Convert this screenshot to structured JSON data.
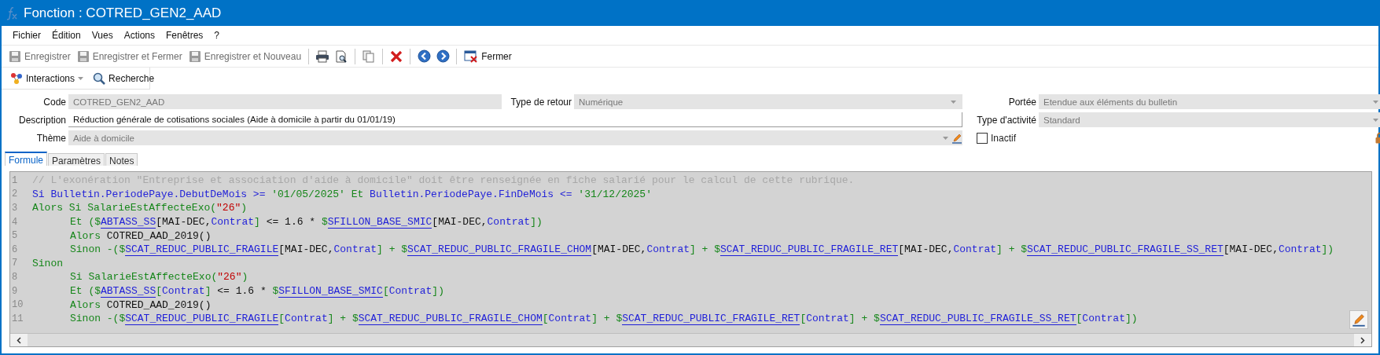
{
  "window": {
    "title": "Fonction : COTRED_GEN2_AAD"
  },
  "menu": [
    "Fichier",
    "Édition",
    "Vues",
    "Actions",
    "Fenêtres",
    "?"
  ],
  "toolbar": {
    "save": {
      "label": "Enregistrer",
      "disabled": true
    },
    "save_close": {
      "label": "Enregistrer et Fermer",
      "disabled": true
    },
    "save_new": {
      "label": "Enregistrer et Nouveau",
      "disabled": true
    },
    "close": {
      "label": "Fermer",
      "disabled": false
    }
  },
  "secondary_toolbar": {
    "interactions": "Interactions",
    "search": "Recherche"
  },
  "form": {
    "code": {
      "label": "Code",
      "value": "COTRED_GEN2_AAD"
    },
    "return_type": {
      "label": "Type de retour",
      "value": "Numérique"
    },
    "scope": {
      "label": "Portée",
      "value": "Etendue aux éléments du bulletin"
    },
    "description": {
      "label": "Description",
      "value": "Réduction générale de cotisations sociales (Aide à domicile à partir du 01/01/19)"
    },
    "activity_type": {
      "label": "Type d'activité",
      "value": "Standard"
    },
    "theme": {
      "label": "Thème",
      "value": "Aide à domicile"
    },
    "inactive": {
      "label": "Inactif",
      "checked": false
    }
  },
  "tabs": [
    {
      "label": "Formule",
      "selected": true
    },
    {
      "label": "Paramètres",
      "selected": false
    },
    {
      "label": "Notes",
      "selected": false
    }
  ],
  "editor": {
    "lines": [
      {
        "number": "1",
        "indented": false,
        "tokens": [
          {
            "kind": "comment",
            "text": "// L'exonération \"Entreprise et association d'aide à domicile\" doit être renseignée en fiche salarié pour le calcul de cette rubrique."
          }
        ]
      },
      {
        "number": "2",
        "indented": false,
        "tokens": [
          {
            "kind": "identifier",
            "text": "Si Bulletin.PeriodePaye.DebutDeMois >= "
          },
          {
            "kind": "keyword",
            "text": "'01/05/2025' Et "
          },
          {
            "kind": "identifier",
            "text": "Bulletin.PeriodePaye.FinDeMois <= "
          },
          {
            "kind": "keyword",
            "text": "'31/12/2025'"
          }
        ]
      },
      {
        "number": "3",
        "indented": false,
        "tokens": [
          {
            "kind": "keyword",
            "text": "Alors Si SalarieEstAffecteExo("
          },
          {
            "kind": "string",
            "text": "\"26\""
          },
          {
            "kind": "keyword",
            "text": ")"
          }
        ]
      },
      {
        "number": "4",
        "indented": true,
        "tokens": [
          {
            "kind": "keyword",
            "text": "Et ($"
          },
          {
            "kind": "variable",
            "text": "ABTASS_SS"
          },
          {
            "kind": "plain",
            "text": "[MAI-DEC,"
          },
          {
            "kind": "identifier",
            "text": "Contrat"
          },
          {
            "kind": "keyword",
            "text": "]"
          },
          {
            "kind": "plain",
            "text": " <= 1.6 * "
          },
          {
            "kind": "keyword",
            "text": "$"
          },
          {
            "kind": "variable",
            "text": "SFILLON_BASE_SMIC"
          },
          {
            "kind": "plain",
            "text": "[MAI-DEC,"
          },
          {
            "kind": "identifier",
            "text": "Contrat"
          },
          {
            "kind": "keyword",
            "text": "])"
          }
        ]
      },
      {
        "number": "5",
        "indented": true,
        "tokens": [
          {
            "kind": "keyword",
            "text": "Alors "
          },
          {
            "kind": "plain",
            "text": "COTRED_AAD_2019()"
          }
        ]
      },
      {
        "number": "6",
        "indented": true,
        "tokens": [
          {
            "kind": "keyword",
            "text": "Sinon -($"
          },
          {
            "kind": "variable",
            "text": "SCAT_REDUC_PUBLIC_FRAGILE"
          },
          {
            "kind": "plain",
            "text": "[MAI-DEC,"
          },
          {
            "kind": "identifier",
            "text": "Contrat"
          },
          {
            "kind": "keyword",
            "text": "] + $"
          },
          {
            "kind": "variable",
            "text": "SCAT_REDUC_PUBLIC_FRAGILE_CHOM"
          },
          {
            "kind": "plain",
            "text": "[MAI-DEC,"
          },
          {
            "kind": "identifier",
            "text": "Contrat"
          },
          {
            "kind": "keyword",
            "text": "] + $"
          },
          {
            "kind": "variable",
            "text": "SCAT_REDUC_PUBLIC_FRAGILE_RET"
          },
          {
            "kind": "plain",
            "text": "[MAI-DEC,"
          },
          {
            "kind": "identifier",
            "text": "Contrat"
          },
          {
            "kind": "keyword",
            "text": "] + $"
          },
          {
            "kind": "variable",
            "text": "SCAT_REDUC_PUBLIC_FRAGILE_SS_RET"
          },
          {
            "kind": "plain",
            "text": "[MAI-DEC,"
          },
          {
            "kind": "identifier",
            "text": "Contrat"
          },
          {
            "kind": "keyword",
            "text": "])"
          }
        ]
      },
      {
        "number": "7",
        "indented": false,
        "tokens": [
          {
            "kind": "keyword",
            "text": "Sinon"
          }
        ]
      },
      {
        "number": "8",
        "indented": true,
        "tokens": [
          {
            "kind": "keyword",
            "text": "Si SalarieEstAffecteExo("
          },
          {
            "kind": "string",
            "text": "\"26\""
          },
          {
            "kind": "keyword",
            "text": ")"
          }
        ]
      },
      {
        "number": "9",
        "indented": true,
        "tokens": [
          {
            "kind": "keyword",
            "text": "Et ($"
          },
          {
            "kind": "variable",
            "text": "ABTASS_SS"
          },
          {
            "kind": "keyword",
            "text": "["
          },
          {
            "kind": "identifier",
            "text": "Contrat"
          },
          {
            "kind": "keyword",
            "text": "]"
          },
          {
            "kind": "plain",
            "text": " <= 1.6 * "
          },
          {
            "kind": "keyword",
            "text": "$"
          },
          {
            "kind": "variable",
            "text": "SFILLON_BASE_SMIC"
          },
          {
            "kind": "keyword",
            "text": "["
          },
          {
            "kind": "identifier",
            "text": "Contrat"
          },
          {
            "kind": "keyword",
            "text": "])"
          }
        ]
      },
      {
        "number": "10",
        "indented": true,
        "tokens": [
          {
            "kind": "keyword",
            "text": "Alors "
          },
          {
            "kind": "plain",
            "text": "COTRED_AAD_2019()"
          }
        ]
      },
      {
        "number": "11",
        "indented": true,
        "tokens": [
          {
            "kind": "keyword",
            "text": "Sinon -($"
          },
          {
            "kind": "variable",
            "text": "SCAT_REDUC_PUBLIC_FRAGILE"
          },
          {
            "kind": "keyword",
            "text": "["
          },
          {
            "kind": "identifier",
            "text": "Contrat"
          },
          {
            "kind": "keyword",
            "text": "] + $"
          },
          {
            "kind": "variable",
            "text": "SCAT_REDUC_PUBLIC_FRAGILE_CHOM"
          },
          {
            "kind": "keyword",
            "text": "["
          },
          {
            "kind": "identifier",
            "text": "Contrat"
          },
          {
            "kind": "keyword",
            "text": "] + $"
          },
          {
            "kind": "variable",
            "text": "SCAT_REDUC_PUBLIC_FRAGILE_RET"
          },
          {
            "kind": "keyword",
            "text": "["
          },
          {
            "kind": "identifier",
            "text": "Contrat"
          },
          {
            "kind": "keyword",
            "text": "] + $"
          },
          {
            "kind": "variable",
            "text": "SCAT_REDUC_PUBLIC_FRAGILE_SS_RET"
          },
          {
            "kind": "keyword",
            "text": "["
          },
          {
            "kind": "identifier",
            "text": "Contrat"
          },
          {
            "kind": "keyword",
            "text": "])"
          }
        ]
      }
    ]
  }
}
